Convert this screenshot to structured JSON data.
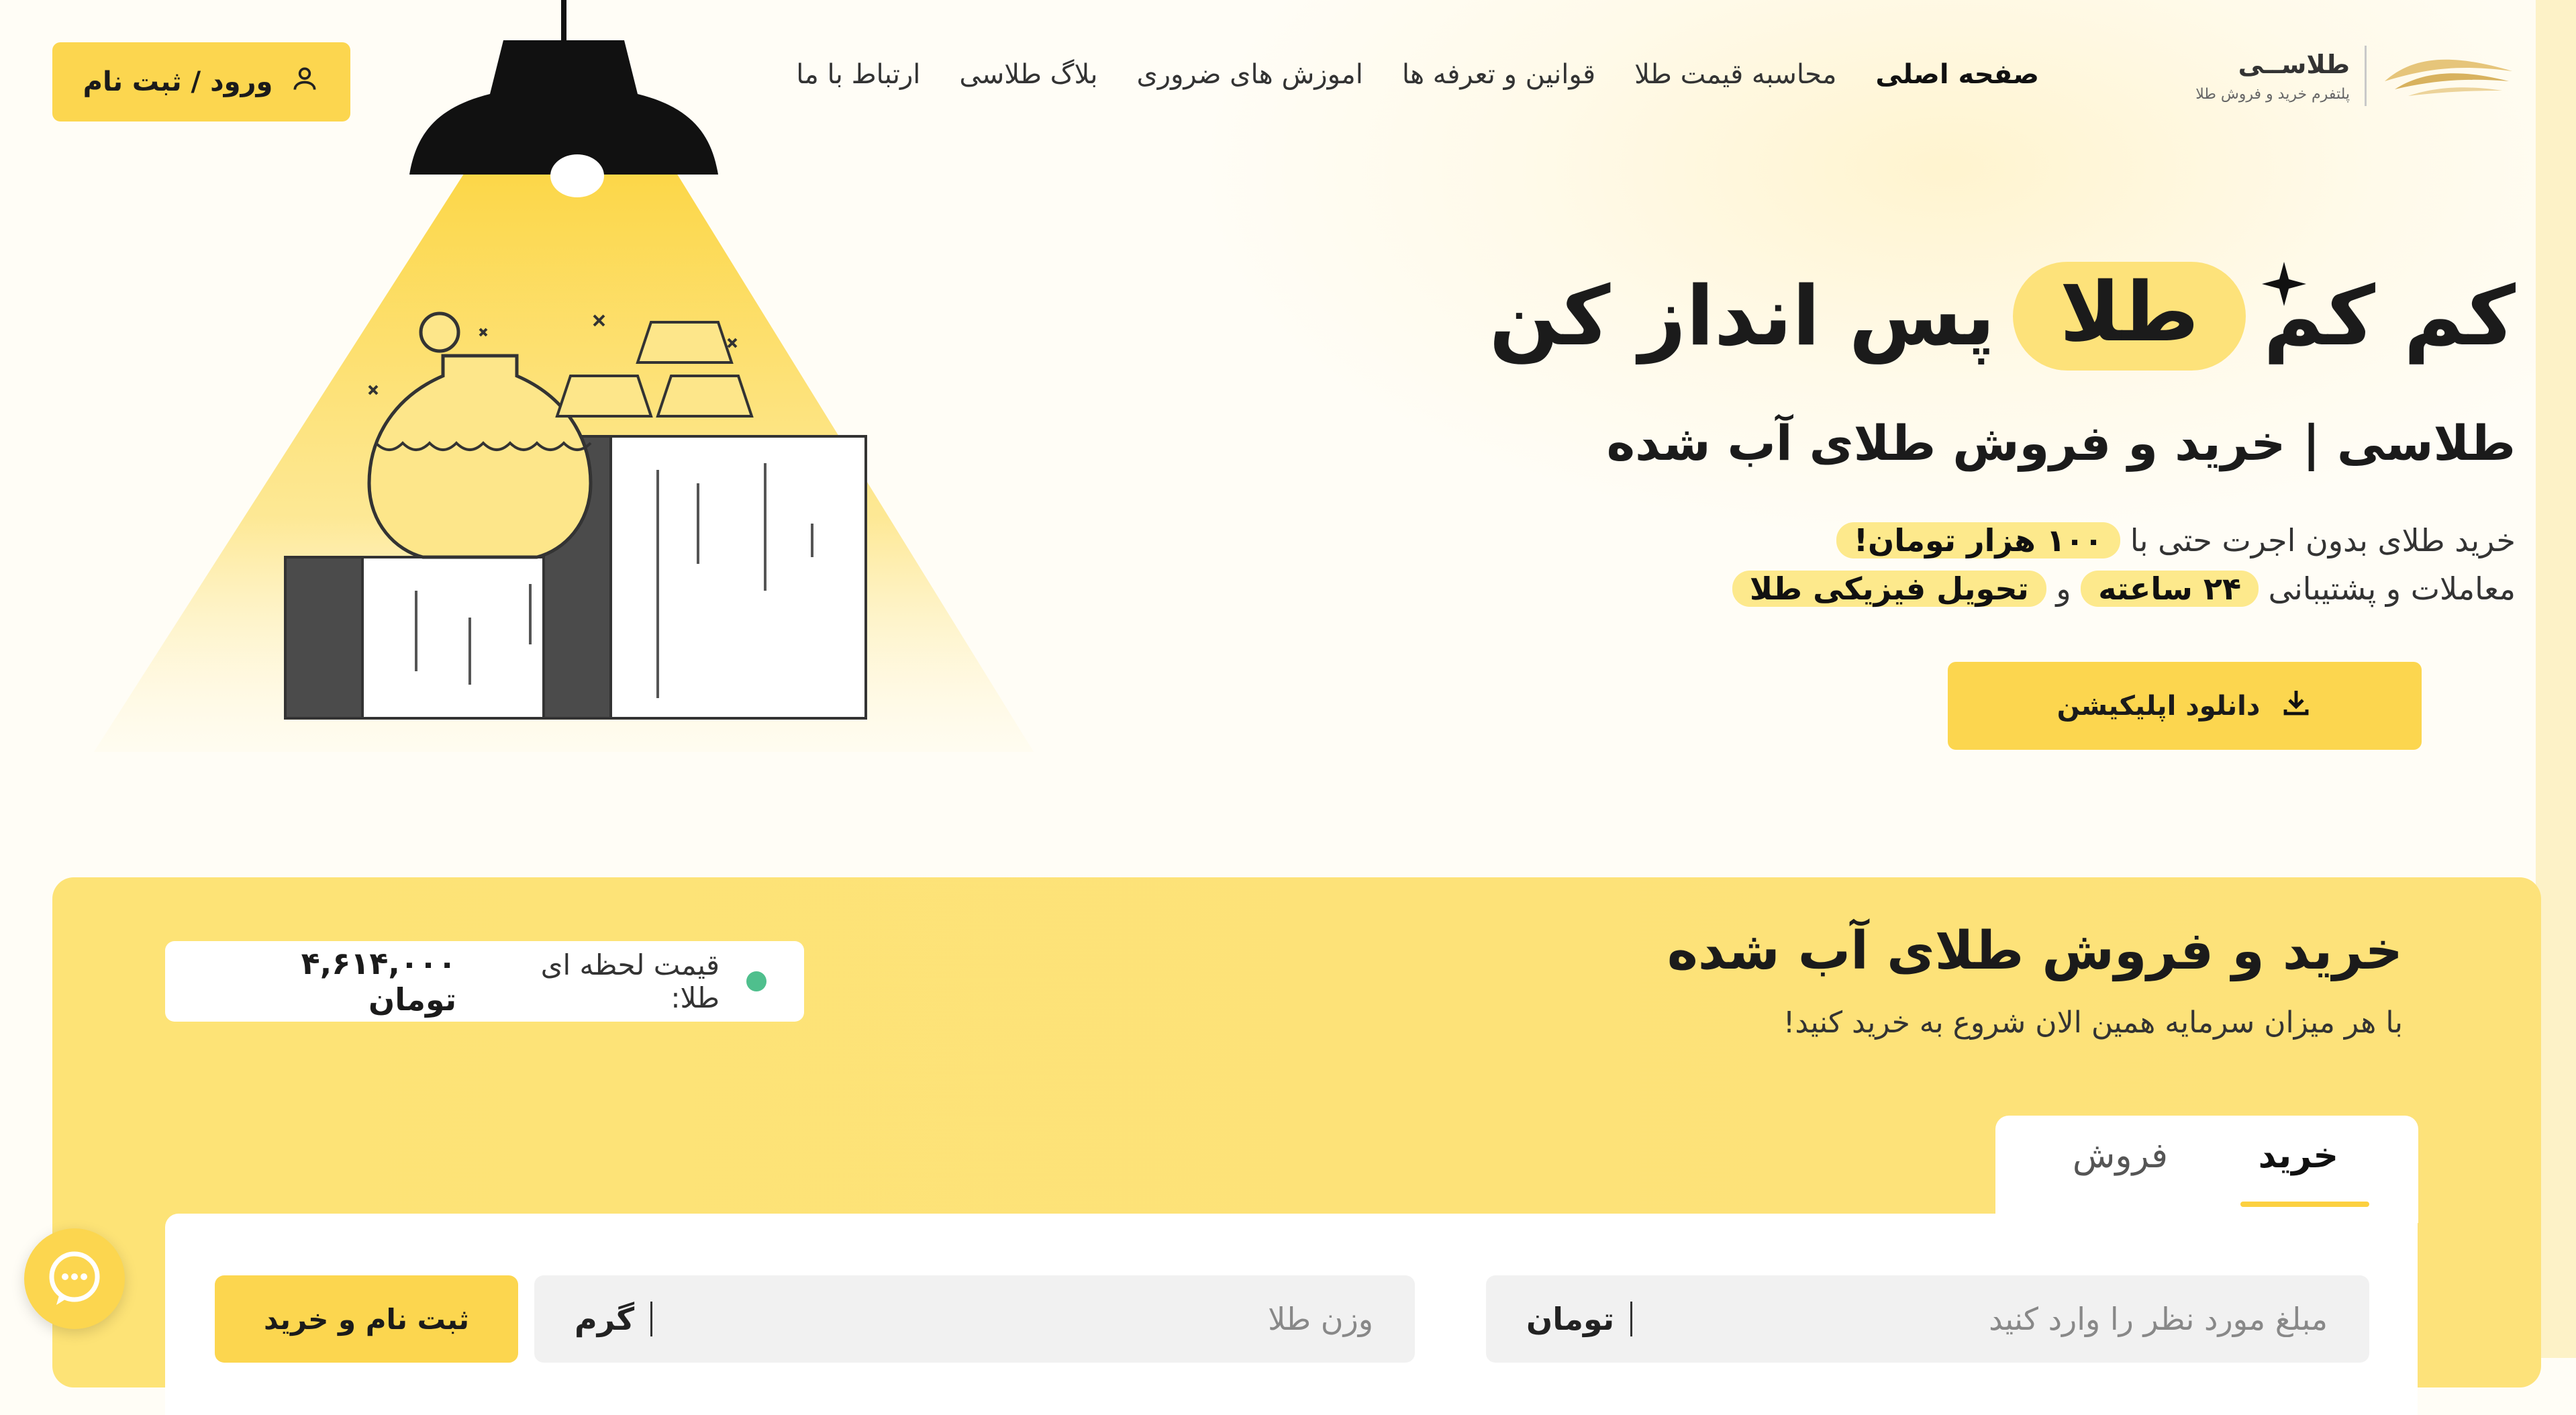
{
  "header": {
    "login_label": "ورود / ثبت نام",
    "nav": [
      {
        "label": "صفحه اصلی",
        "active": true
      },
      {
        "label": "محاسبه قیمت طلا",
        "active": false
      },
      {
        "label": "قوانین و تعرفه ها",
        "active": false
      },
      {
        "label": "اموزش های ضروری",
        "active": false
      },
      {
        "label": "بلاگ طلاسی",
        "active": false
      },
      {
        "label": "ارتباط با ما",
        "active": false
      }
    ],
    "logo_title": "طلاســی",
    "logo_subtitle": "پلتفرم خرید و فروش طلا"
  },
  "hero": {
    "title_part1": "کم کم",
    "title_highlight": "طلا",
    "title_part2": "پس انداز کن",
    "subtitle": "طلاسی | خرید و فروش طلای آب شده",
    "line1_text": "خرید طلای بدون اجرت حتی با",
    "line1_highlight": "۱۰۰ هزار تومان!",
    "line2_text": "معاملات و پشتیبانی",
    "line2_hl1": "۲۴ ساعته",
    "line2_and": "و",
    "line2_hl2": "تحویل فیزیکی طلا",
    "download_label": "دانلود اپلیکیشن"
  },
  "trade": {
    "title": "خرید و فروش طلای آب شده",
    "subtitle": "با هر میزان سرمایه همین الان شروع به خرید کنید!",
    "price_label": "قیمت لحظه ای طلا:",
    "price_value": "۴,۶۱۴,۰۰۰ تومان",
    "tabs": [
      {
        "label": "خرید",
        "active": true
      },
      {
        "label": "فروش",
        "active": false
      }
    ],
    "amount_placeholder": "مبلغ مورد نظر را وارد کنید",
    "amount_unit": "تومان",
    "weight_placeholder": "وزن طلا",
    "weight_unit": "گرم",
    "submit_label": "ثبت نام و خرید"
  },
  "colors": {
    "accent": "#fcd64f",
    "panel": "#fde27a",
    "status_dot": "#4fbf8d"
  },
  "icons": {
    "login": "user-icon",
    "download": "download-icon",
    "chat": "chat-bubble-icon",
    "logo": "gold-wave-logo-icon"
  }
}
